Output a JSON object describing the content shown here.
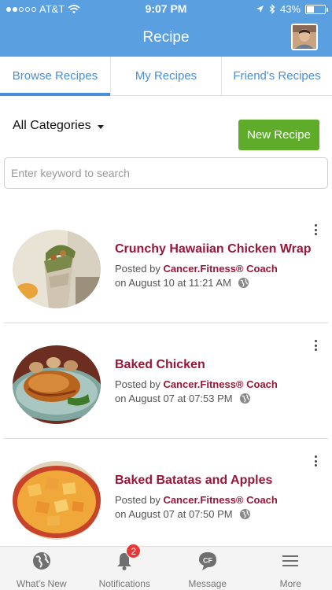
{
  "status_bar": {
    "carrier": "AT&T",
    "time": "9:07 PM",
    "battery_percent": "43%",
    "battery_level": 0.43,
    "icons": [
      "signal-icon",
      "wifi-icon",
      "location-icon",
      "bluetooth-icon",
      "battery-icon"
    ]
  },
  "header": {
    "title": "Recipe",
    "avatar_icon": "user-avatar"
  },
  "tabs": [
    {
      "label": "Browse Recipes",
      "active": true
    },
    {
      "label": "My Recipes",
      "active": false
    },
    {
      "label": "Friend's Recipes",
      "active": false
    }
  ],
  "filters": {
    "category_label": "All Categories",
    "new_recipe_label": "New Recipe",
    "search_placeholder": "Enter keyword to search",
    "search_value": ""
  },
  "recipes": [
    {
      "title": "Crunchy Hawaiian Chicken Wrap",
      "posted_by_prefix": "Posted by ",
      "author": "Cancer.Fitness® Coach",
      "date": "on August 10 at 11:21 AM",
      "visibility_icon": "globe-icon"
    },
    {
      "title": "Baked Chicken",
      "posted_by_prefix": "Posted by ",
      "author": "Cancer.Fitness® Coach",
      "date": "on August 07 at 07:53 PM",
      "visibility_icon": "globe-icon"
    },
    {
      "title": "Baked Batatas and Apples",
      "posted_by_prefix": "Posted by ",
      "author": "Cancer.Fitness® Coach",
      "date": "on August 07 at 07:50 PM",
      "visibility_icon": "globe-icon"
    }
  ],
  "bottom_nav": [
    {
      "label": "What's New",
      "icon": "globe-icon"
    },
    {
      "label": "Notifications",
      "icon": "bell-icon",
      "badge": "2"
    },
    {
      "label": "Message",
      "icon": "cf-message-icon"
    },
    {
      "label": "More",
      "icon": "menu-icon"
    }
  ],
  "colors": {
    "header_bg": "#5a9fe0",
    "tab_accent": "#4a8fd8",
    "button_green": "#5fac2a",
    "recipe_title": "#9a1638",
    "badge_red": "#e53935"
  }
}
